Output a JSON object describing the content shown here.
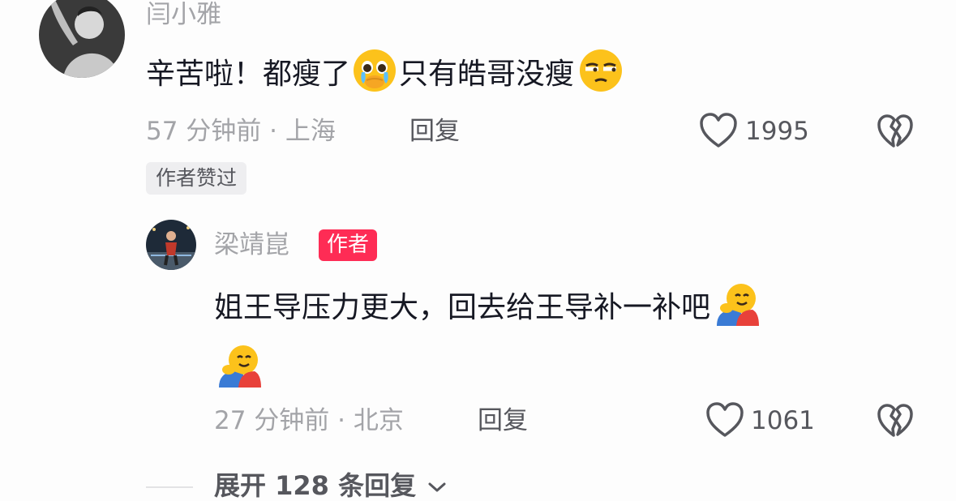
{
  "comment": {
    "username": "闫小雅",
    "text_part1": "辛苦啦！都瘦了",
    "text_part2": "只有皓哥没瘦",
    "time_location": "57 分钟前 · 上海",
    "reply_label": "回复",
    "like_count": "1995",
    "liked_by_author_badge": "作者赞过"
  },
  "reply": {
    "username": "梁靖崑",
    "author_badge": "作者",
    "text_line1": "姐王导压力更大，回去给王导补一补吧",
    "time_location": "27 分钟前 · 北京",
    "reply_label": "回复",
    "like_count": "1061"
  },
  "expand": {
    "label": "展开 128 条回复"
  },
  "icons": {
    "heart": "heart-outline-icon",
    "dislike": "broken-heart-icon",
    "chevron": "chevron-down-icon"
  },
  "colors": {
    "author_badge_bg": "#fe2c55",
    "muted_text": "#a3a4a8",
    "body_text": "#161823"
  }
}
